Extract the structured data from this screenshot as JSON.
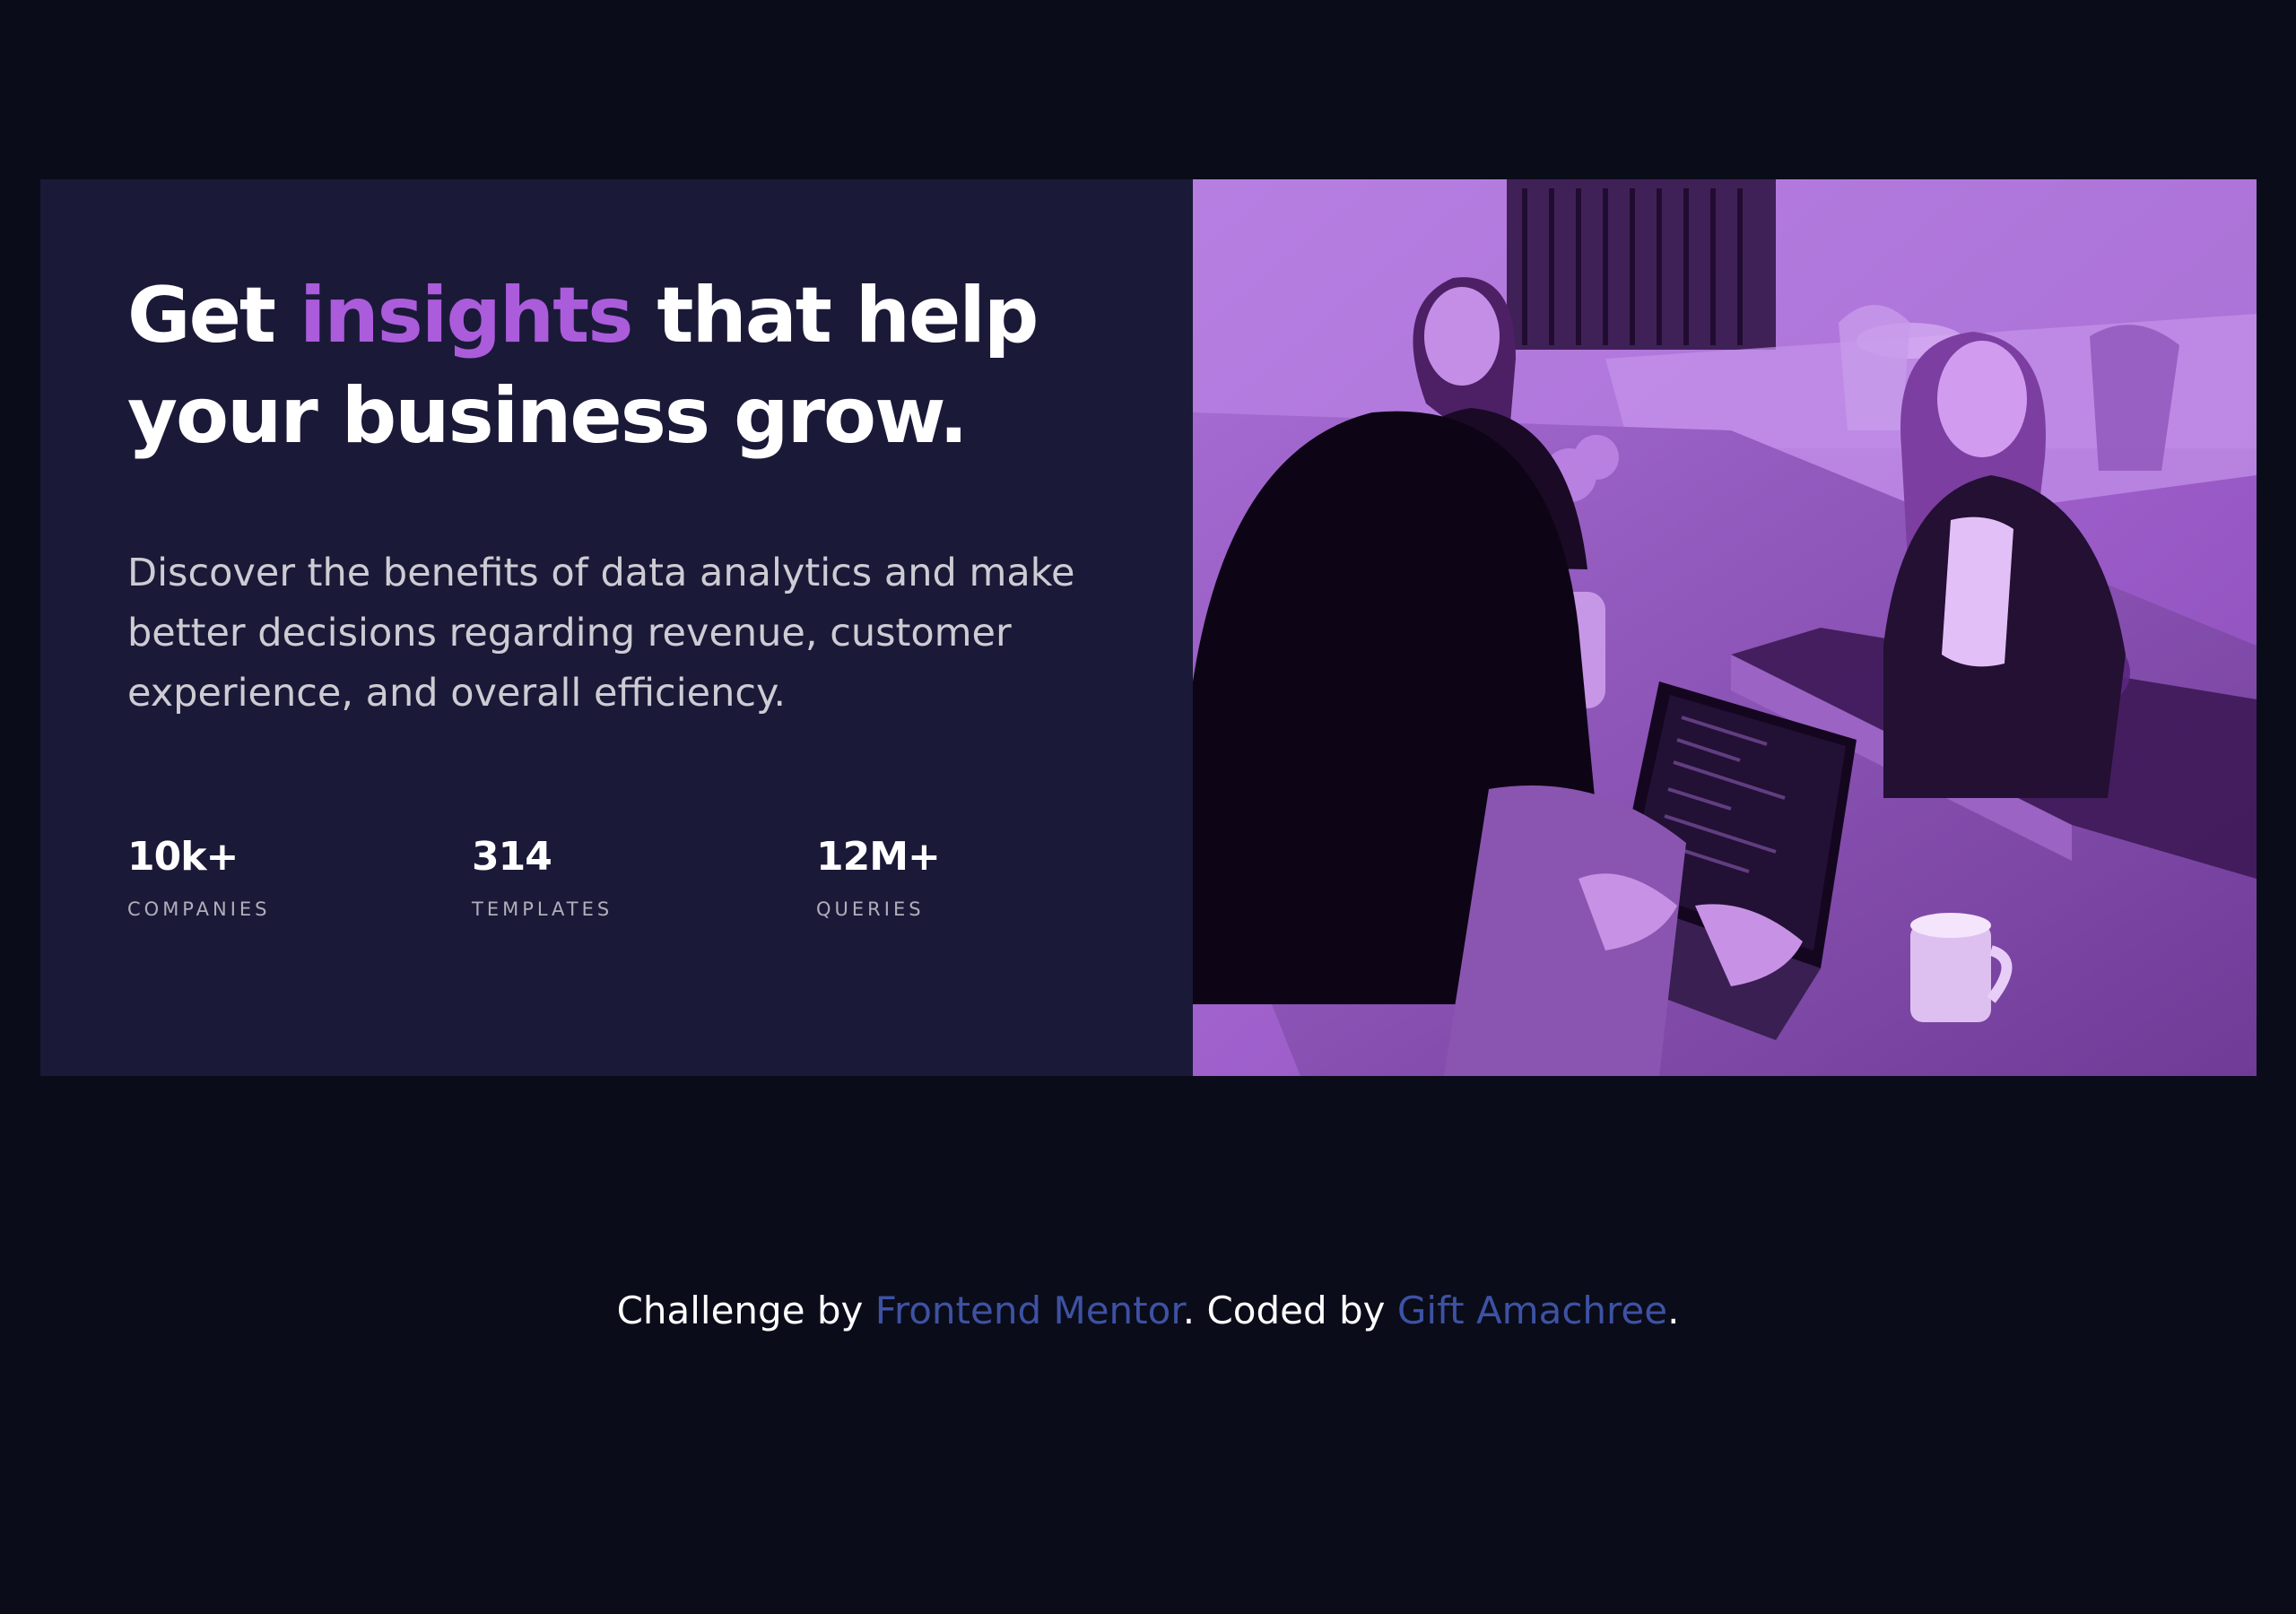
{
  "hero": {
    "headline": {
      "part1": "Get ",
      "accent": "insights",
      "part2": " that help your business grow."
    },
    "description": "Discover the benefits of data analytics and make better decisions regarding revenue, customer experience, and overall efficiency.",
    "stats": [
      {
        "value": "10k+",
        "label": "COMPANIES"
      },
      {
        "value": "314",
        "label": "TEMPLATES"
      },
      {
        "value": "12M+",
        "label": "QUERIES"
      }
    ],
    "image": {
      "subject": "three women working around a table with a laptop and plants",
      "overlay_color": "#aa5cdb"
    }
  },
  "attribution": {
    "prefix": "Challenge by ",
    "link1": "Frontend Mentor",
    "middle": ". Coded by ",
    "link2": "Gift Amachree",
    "suffix": "."
  },
  "colors": {
    "page_background": "#0a0c1a",
    "card_background": "#1b1938",
    "accent": "#aa5cdb",
    "link": "#3e52a3",
    "text_primary": "#ffffff"
  }
}
